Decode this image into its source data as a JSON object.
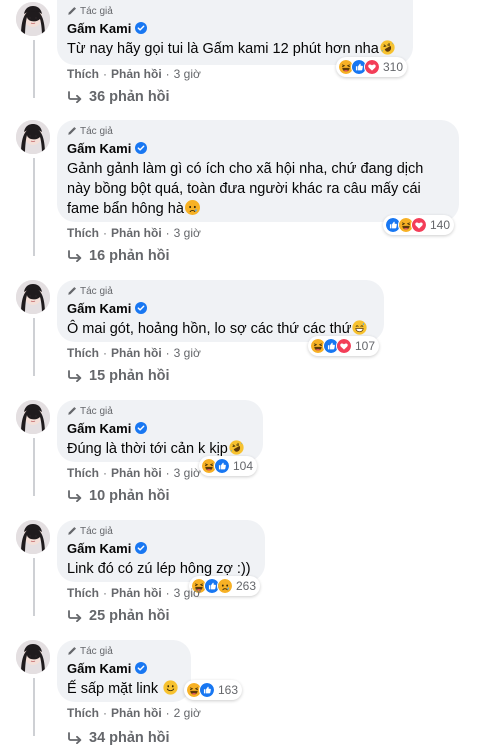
{
  "comments": [
    {
      "author_tag": "Tác giả",
      "author": "Gấm Kami",
      "text": "Từ nay hãy gọi tui là Gấm kami 12 phút hơn nha",
      "text_emoji": "rofl-emoji",
      "reactions": [
        "haha",
        "like",
        "love"
      ],
      "reaction_count": "310",
      "like": "Thích",
      "reply": "Phản hồi",
      "time": "3 giờ",
      "replies": "36 phản hồi"
    },
    {
      "author_tag": "Tác giả",
      "author": "Gấm Kami",
      "text": "Gảnh gảnh làm gì có ích cho xã hội nha, chứ đang dịch này bồng bột quá, toàn đưa người khác ra câu mấy cái fame bẩn hông hà",
      "text_emoji": "sad-emoji",
      "reactions": [
        "like",
        "haha",
        "love"
      ],
      "reaction_count": "140",
      "like": "Thích",
      "reply": "Phản hồi",
      "time": "3 giờ",
      "replies": "16 phản hồi"
    },
    {
      "author_tag": "Tác giả",
      "author": "Gấm Kami",
      "text": "Ô mai gót, hoảng hồn, lo sợ các thứ các thứ",
      "text_emoji": "grin-sweat-emoji",
      "reactions": [
        "haha",
        "like",
        "love"
      ],
      "reaction_count": "107",
      "like": "Thích",
      "reply": "Phản hồi",
      "time": "3 giờ",
      "replies": "15 phản hồi"
    },
    {
      "author_tag": "Tác giả",
      "author": "Gấm Kami",
      "text": "Đúng là thời tới cản k kịp",
      "text_emoji": "rofl-emoji",
      "reactions": [
        "haha",
        "like"
      ],
      "reaction_count": "104",
      "like": "Thích",
      "reply": "Phản hồi",
      "time": "3 giờ",
      "replies": "10 phản hồi"
    },
    {
      "author_tag": "Tác giả",
      "author": "Gấm Kami",
      "text": "Link đó có zú lép hông zợ :))",
      "text_emoji": "",
      "reactions": [
        "haha",
        "like",
        "sad"
      ],
      "reaction_count": "263",
      "like": "Thích",
      "reply": "Phản hồi",
      "time": "3 giờ",
      "replies": "25 phản hồi"
    },
    {
      "author_tag": "Tác giả",
      "author": "Gấm Kami",
      "text": "Ế sấp mặt link",
      "text_emoji": "smile-emoji",
      "reactions": [
        "haha",
        "like"
      ],
      "reaction_count": "163",
      "like": "Thích",
      "reply": "Phản hồi",
      "time": "2 giờ",
      "replies": "34 phản hồi"
    }
  ],
  "colors": {
    "like": "#1877f2",
    "love": "#f33e58",
    "haha": "#f7b125",
    "muted": "#65676b",
    "bubble": "#f0f2f5"
  }
}
